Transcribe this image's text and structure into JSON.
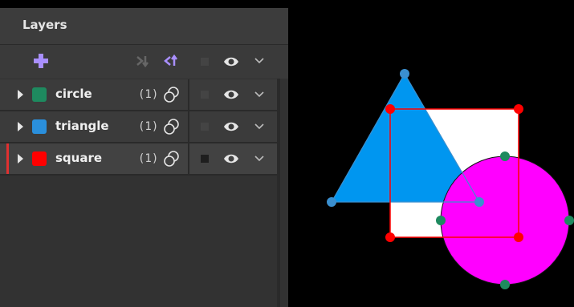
{
  "panel": {
    "title": "Layers"
  },
  "layers": [
    {
      "name": "circle",
      "count": "(1)",
      "color": "#1e8a5f"
    },
    {
      "name": "triangle",
      "count": "(1)",
      "color": "#2a8fdc"
    },
    {
      "name": "square",
      "count": "(1)",
      "color": "#ff0000",
      "selected": true
    }
  ],
  "colors": {
    "accent": "#a98fff",
    "selection": "#ff0000",
    "triangle_fill": "#0096f0",
    "circle_fill": "#ff00ff",
    "square_fill": "#ffffff",
    "circle_handle": "#1e8a5f",
    "triangle_handle": "#3a8fcf"
  },
  "icons": {
    "add": "plus-icon",
    "move_down": "move-down-icon",
    "move_up": "move-up-icon",
    "visibility": "eye-icon",
    "expand": "chevron-down-icon",
    "instances": "overlapping-circles-icon"
  }
}
